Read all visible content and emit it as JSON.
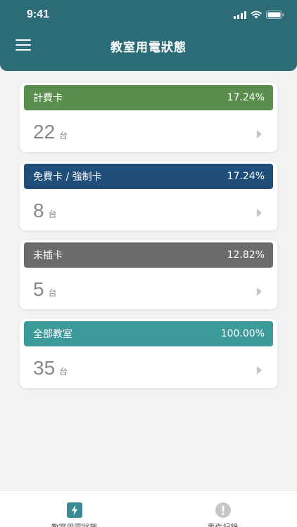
{
  "status_bar": {
    "time": "9:41"
  },
  "header": {
    "title": "教室用電狀態"
  },
  "colors": {
    "header_bg": "#2b6c78",
    "paid": "#5a8e4e",
    "free": "#1f4f78",
    "not_inserted": "#6b6b6b",
    "all": "#3d9a9b",
    "tab_active": "#3a8a94",
    "tab_inactive": "#c6c6c6"
  },
  "cards": [
    {
      "label": "計費卡",
      "percent": "17.24%",
      "count": "22",
      "unit": "台"
    },
    {
      "label": "免費卡 / 強制卡",
      "percent": "17.24%",
      "count": "8",
      "unit": "台"
    },
    {
      "label": "未插卡",
      "percent": "12.82%",
      "count": "5",
      "unit": "台"
    },
    {
      "label": "全部教室",
      "percent": "100.00%",
      "count": "35",
      "unit": "台"
    }
  ],
  "tabs": [
    {
      "label": "教室用電狀態",
      "icon": "lightning-icon"
    },
    {
      "label": "事件紀錄",
      "icon": "alert-icon"
    }
  ]
}
